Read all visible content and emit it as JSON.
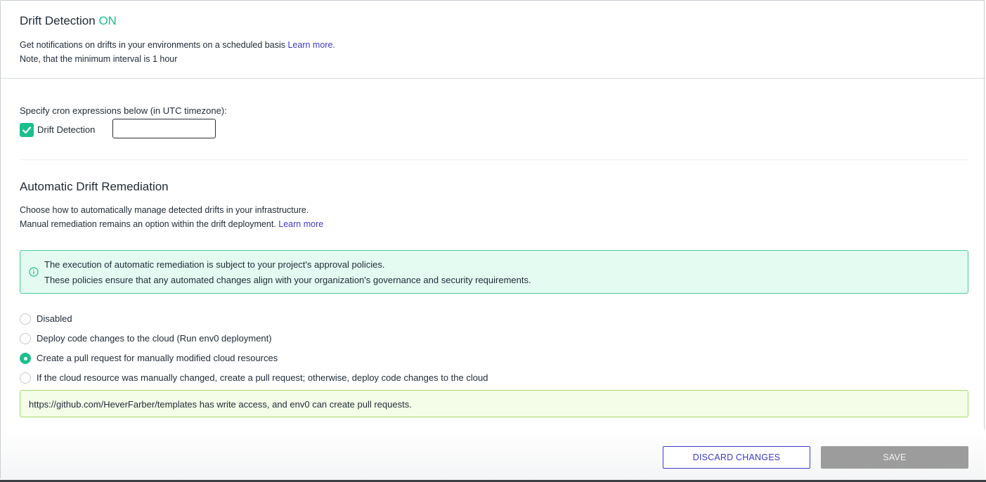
{
  "header": {
    "title_prefix": "Drift Detection",
    "title_status": "ON",
    "description": "Get notifications on drifts in your environments on a scheduled basis",
    "learn_more": "Learn more.",
    "note": "Note, that the minimum interval is 1 hour"
  },
  "cron": {
    "label": "Specify cron expressions below (in UTC timezone):",
    "checkbox_label": "Drift Detection",
    "checkbox_checked": true,
    "input_value": ""
  },
  "remediation": {
    "title": "Automatic Drift Remediation",
    "desc_line1": "Choose how to automatically manage detected drifts in your infrastructure.",
    "desc_line2": "Manual remediation remains an option within the drift deployment.",
    "learn_more": "Learn more",
    "info_line1": "The execution of automatic remediation is subject to your project's approval policies.",
    "info_line2": "These policies ensure that any automated changes align with your organization's governance and security requirements.",
    "options": [
      {
        "label": "Disabled",
        "checked": false
      },
      {
        "label": "Deploy code changes to the cloud (Run env0 deployment)",
        "checked": false
      },
      {
        "label": "Create a pull request for manually modified cloud resources",
        "checked": true
      },
      {
        "label": "If the cloud resource was manually changed, create a pull request; otherwise, deploy code changes to the cloud",
        "checked": false
      }
    ],
    "access_message": "https://github.com/HeverFarber/templates has write access, and env0 can create pull requests."
  },
  "actions": {
    "discard_label": "DISCARD CHANGES",
    "save_label": "SAVE"
  },
  "colors": {
    "accent": "#1bbf8e",
    "link": "#3d3bc5",
    "save_disabled": "#9c9c9c"
  }
}
